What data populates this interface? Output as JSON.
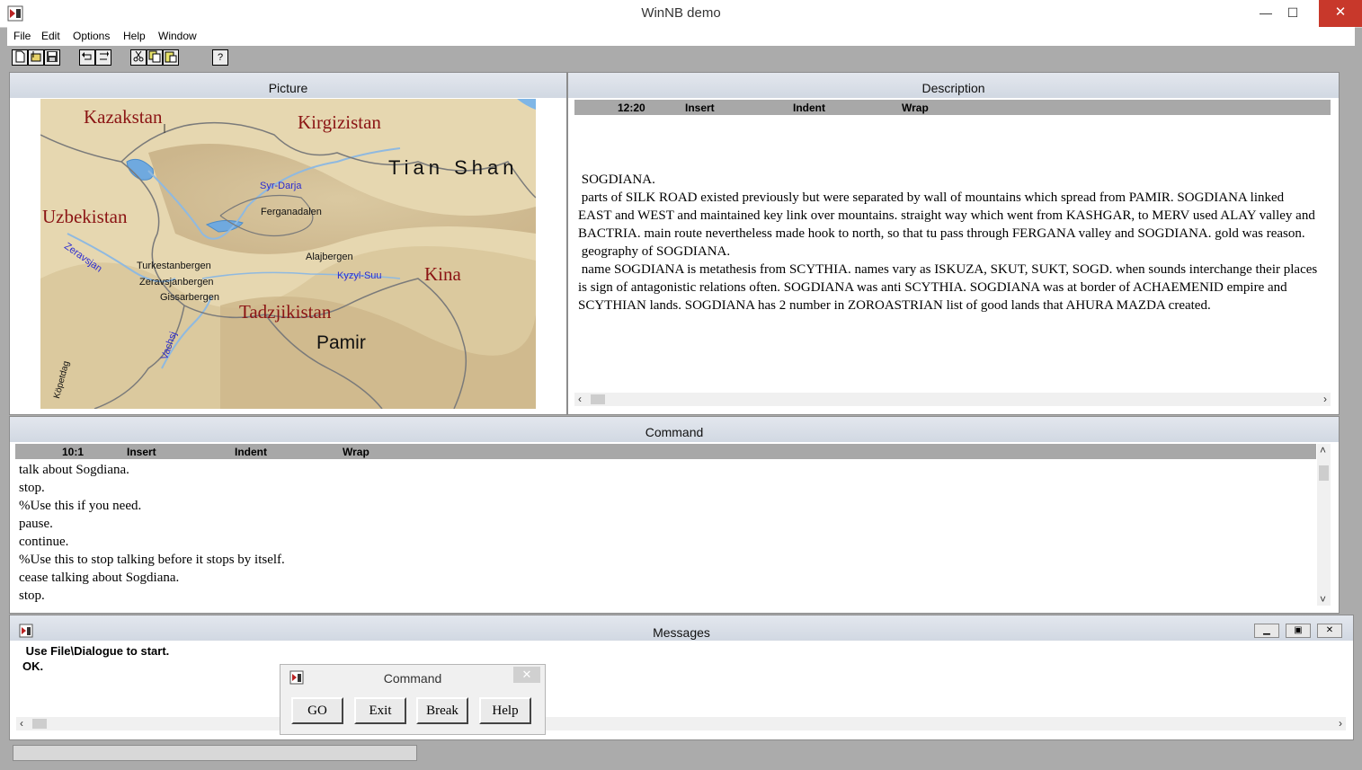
{
  "window": {
    "title": "WinNB demo",
    "min": "—",
    "max": "☐",
    "close": "✕"
  },
  "menu": [
    "File",
    "Edit",
    "Options",
    "Help",
    "Window"
  ],
  "toolbar": {
    "help": "?"
  },
  "picture": {
    "title": "Picture",
    "map_labels": {
      "kazakstan": "Kazakstan",
      "kirgizistan": "Kirgizistan",
      "tian_shan": "Tian Shan",
      "uzbekistan": "Uzbekistan",
      "syr_darja": "Syr-Darja",
      "ferganadalen": "Ferganadalen",
      "zeravsjan": "Zeravsjan",
      "turkestanbergen": "Turkestanbergen",
      "zeravsjanbergen": "Zeravsjanbergen",
      "gissarbergen": "Gissarbergen",
      "alajbergen": "Alajbergen",
      "kyzyl_suu": "Kyzyl-Suu",
      "kina": "Kina",
      "tadzjikistan": "Tadzjikistan",
      "pamir": "Pamir",
      "vachsj": "Vachsj",
      "kopetdag": "Köpetdag"
    }
  },
  "description": {
    "title": "Description",
    "status": {
      "position": "12:20",
      "mode": "Insert",
      "indent": "Indent",
      "wrap": "Wrap"
    },
    "text": " SOGDIANA.\n parts of SILK ROAD existed previously but were separated by wall of mountains which spread from PAMIR. SOGDIANA linked EAST and WEST and maintained key link over mountains. straight way which went from KASHGAR, to MERV used ALAY valley and BACTRIA. main route nevertheless made hook to north, so that tu pass through FERGANA valley and SOGDIANA. gold was reason.\n geography of SOGDIANA.\n name SOGDIANA is metathesis from SCYTHIA. names vary as ISKUZA, SKUT, SUKT, SOGD. when sounds interchange their places is sign of antagonistic relations often. SOGDIANA was anti SCYTHIA. SOGDIANA was at border of ACHAEMENID empire and SCYTHIAN lands. SOGDIANA has 2 number in ZOROASTRIAN list of good lands that AHURA MAZDA created."
  },
  "command": {
    "title": "Command",
    "status": {
      "position": "10:1",
      "mode": "Insert",
      "indent": "Indent",
      "wrap": "Wrap"
    },
    "lines": [
      "talk about Sogdiana.",
      "stop.",
      "%Use this if you need.",
      "pause.",
      "continue.",
      "%Use this to stop talking before it stops by itself.",
      "cease talking about Sogdiana.",
      "stop."
    ]
  },
  "messages": {
    "title": "Messages",
    "lines": [
      " Use File\\Dialogue to start.",
      "OK."
    ]
  },
  "dialog": {
    "title": "Command",
    "close": "✕",
    "buttons": {
      "go": "GO",
      "exit": "Exit",
      "break": "Break",
      "help": "Help"
    }
  }
}
